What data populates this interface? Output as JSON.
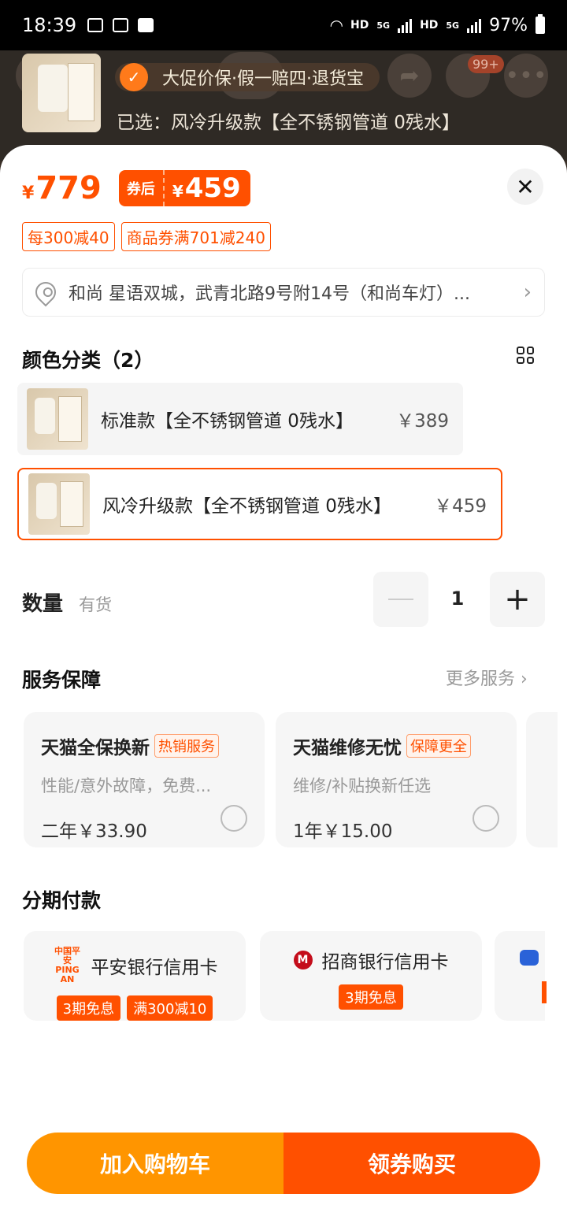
{
  "status_bar": {
    "time": "18:39",
    "network_labels": [
      "HD",
      "5G",
      "HD",
      "5G"
    ],
    "battery": "97%"
  },
  "backdrop": {
    "cart_badge": "99+",
    "promo": "大促价保·假一赔四·退货宝",
    "selected_text": "已选：风冷升级款【全不锈钢管道 0残水】"
  },
  "price": {
    "currency": "¥",
    "original": "779",
    "after_label": "券后",
    "after_price": "459"
  },
  "coupons": [
    "每300减40",
    "商品券满701减240"
  ],
  "address": "和尚 星语双城，武青北路9号附14号（和尚车灯）...",
  "color_section": {
    "title": "颜色分类（2）",
    "options": [
      {
        "label": "标准款【全不锈钢管道 0残水】",
        "price": "￥389",
        "selected": false
      },
      {
        "label": "风冷升级款【全不锈钢管道 0残水】",
        "price": "￥459",
        "selected": true
      }
    ]
  },
  "quantity": {
    "label": "数量",
    "stock": "有货",
    "value": "1"
  },
  "service": {
    "title": "服务保障",
    "more": "更多服务",
    "cards": [
      {
        "title": "天猫全保换新",
        "tag": "热销服务",
        "desc": "性能/意外故障，免费...",
        "price": "二年￥33.90"
      },
      {
        "title": "天猫维修无忧",
        "tag": "保障更全",
        "desc": "维修/补贴换新任选",
        "price": "1年￥15.00"
      }
    ]
  },
  "installment": {
    "title": "分期付款",
    "cards": [
      {
        "logo": "中国平安 PING AN",
        "title": "平安银行信用卡",
        "tags": [
          "3期免息",
          "满300减10"
        ]
      },
      {
        "logo": "M",
        "title": "招商银行信用卡",
        "tags": [
          "3期免息"
        ]
      }
    ]
  },
  "actions": {
    "add_to_cart": "加入购物车",
    "buy": "领券购买"
  },
  "colors": {
    "accent": "#ff5000",
    "cart_button": "#ff9500"
  }
}
